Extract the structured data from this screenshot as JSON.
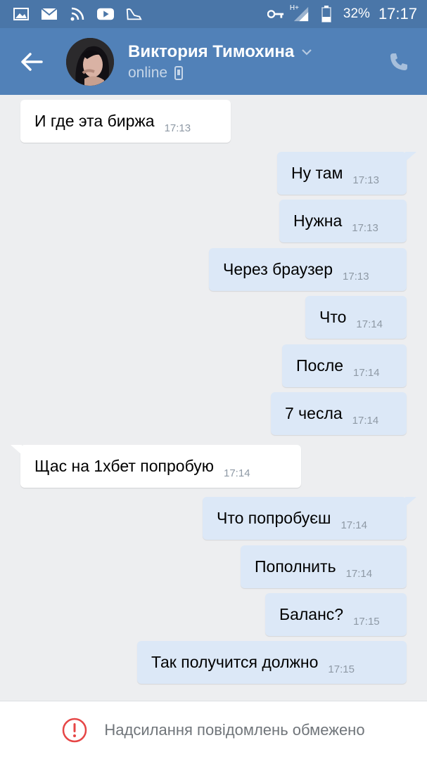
{
  "status_bar": {
    "battery": "32%",
    "time": "17:17",
    "network": "H+"
  },
  "header": {
    "name": "Виктория Тимохина",
    "status": "online"
  },
  "messages": [
    {
      "dir": "in",
      "text": "И где эта биржа",
      "time": "17:13"
    },
    {
      "dir": "out",
      "text": "Ну там",
      "time": "17:13"
    },
    {
      "dir": "out",
      "text": "Нужна",
      "time": "17:13"
    },
    {
      "dir": "out",
      "text": "Через браузер",
      "time": "17:13"
    },
    {
      "dir": "out",
      "text": "Что",
      "time": "17:14"
    },
    {
      "dir": "out",
      "text": "После",
      "time": "17:14"
    },
    {
      "dir": "out",
      "text": "7 чесла",
      "time": "17:14"
    },
    {
      "dir": "in",
      "text": "Щас на 1хбет попробую",
      "time": "17:14"
    },
    {
      "dir": "out",
      "text": "Что попробуєш",
      "time": "17:14"
    },
    {
      "dir": "out",
      "text": "Пополнить",
      "time": "17:14"
    },
    {
      "dir": "out",
      "text": "Баланс?",
      "time": "17:15"
    },
    {
      "dir": "out",
      "text": "Так получится должно",
      "time": "17:15"
    }
  ],
  "footer": {
    "notice": "Надсилання повідомлень обмежено"
  },
  "colors": {
    "status_bar": "#4a76a8",
    "header": "#5181b8",
    "background": "#edeef0",
    "incoming_bubble": "#ffffff",
    "outgoing_bubble": "#dce8f7",
    "warning": "#e64646"
  }
}
